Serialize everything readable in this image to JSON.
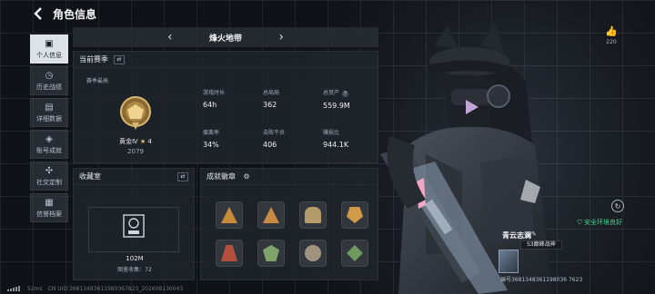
{
  "header": {
    "title": "角色信息"
  },
  "nav": [
    {
      "label": "个人信息",
      "icon": "person-card-icon",
      "active": true
    },
    {
      "label": "历史战绩",
      "icon": "history-icon",
      "active": false
    },
    {
      "label": "详细数据",
      "icon": "chart-icon",
      "active": false
    },
    {
      "label": "账号成就",
      "icon": "trophy-icon",
      "active": false
    },
    {
      "label": "社交定制",
      "icon": "social-icon",
      "active": false
    },
    {
      "label": "信誉档案",
      "icon": "credit-icon",
      "active": false
    }
  ],
  "mode_tab": {
    "label": "烽火地带"
  },
  "season": {
    "title": "当前赛季",
    "sub_label": "赛季最高",
    "rank_name": "黄金Ⅳ",
    "rank_stars": "4",
    "rank_score": "2079",
    "stats": [
      {
        "key": "游戏时长",
        "value": "64h"
      },
      {
        "key": "总局局",
        "value": "362"
      },
      {
        "key": "总资产",
        "value": "559.9M",
        "help": "?"
      },
      {
        "key": "撤离率",
        "value": "34%"
      },
      {
        "key": "击败干员",
        "value": "406"
      },
      {
        "key": "赚损比",
        "value": "944.1K"
      }
    ]
  },
  "collection": {
    "title": "收藏室",
    "value": "102M",
    "count_label": "图鉴收集：72"
  },
  "achievements": {
    "title": "成就徽章",
    "medals": [
      {
        "icon": "medal-gold-triangle-icon",
        "color": "#c68a3a"
      },
      {
        "icon": "medal-bronze-triangle-icon",
        "color": "#c88b44"
      },
      {
        "icon": "medal-soldier-icon",
        "color": "#b59a6a"
      },
      {
        "icon": "medal-gold-emblem-icon",
        "color": "#d09a48"
      },
      {
        "icon": "medal-red-tower-icon",
        "color": "#b4503e"
      },
      {
        "icon": "medal-green-crest-icon",
        "color": "#7fa36a"
      },
      {
        "icon": "medal-round-seal-icon",
        "color": "#a09480"
      },
      {
        "icon": "medal-green-emblem-icon",
        "color": "#6f9a5f"
      }
    ]
  },
  "status_bar": {
    "ping": "52ms",
    "uid": "CN UID:368134836119803678​23_202608130043"
  },
  "social": {
    "like_count": "220"
  },
  "safety": {
    "label": "安全环境良好"
  },
  "player": {
    "name": "青云志澜",
    "title_tag": "S3巅峰战神",
    "uid_line": "编号3681348361198036 7623"
  },
  "colors": {
    "accent_green": "#46d58a",
    "gold": "#e1c275"
  }
}
